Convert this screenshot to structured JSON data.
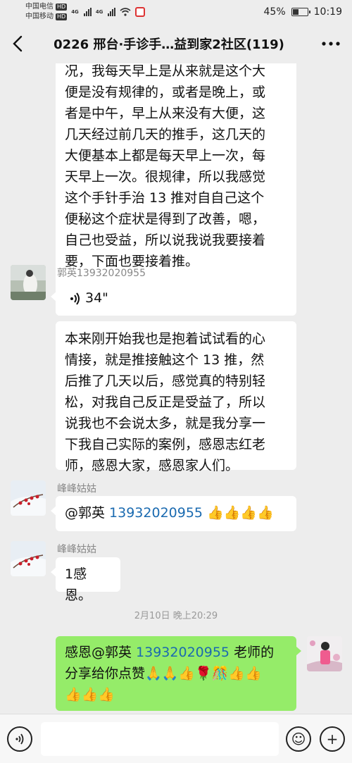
{
  "status_bar": {
    "carrier_1": "中国电信",
    "carrier_2": "中国移动",
    "hd": "HD",
    "network": "4G",
    "battery_percent": "45%",
    "battery_level": 0.45,
    "time": "10:19"
  },
  "nav": {
    "back_icon": "back-chevron-icon",
    "title": "0226 邢台·手诊手…益到家2社区(119)",
    "more_icon": "more-dots-icon"
  },
  "messages": {
    "m1": {
      "lines": [
        "况，我每天早上是从来就是这个大",
        "便是没有规律的，或者是晚上，或",
        "者是中午，早上从来没有大便，这",
        "几天经过前几天的推手，这几天的",
        "大便基本上都是每天早上一次，每",
        "天早上一次。很规律，所以我感觉",
        "这个手针手治 13 推对自自己这个",
        "便秘这个症状是得到了改善，嗯，",
        "自己也受益，所以说我说我要接着",
        "要，下面也要接着推。"
      ]
    },
    "m2": {
      "sender": "郭英13932020955",
      "voice_duration": "34\""
    },
    "m3": {
      "lines": [
        "本来刚开始我也是抱着试试看的心",
        "情接，就是推接触这个 13 推，然",
        "后推了几天以后，感觉真的特别轻",
        "松，对我自己反正是受益了，所以",
        "说我也不会说太多，就是我分享一",
        "下我自己实际的案例，感恩志红老",
        "师，感恩大家，感恩家人们。"
      ]
    },
    "m4": {
      "sender": "峰峰姑姑",
      "mention": "@郭英 ",
      "phone": "13932020955",
      "emoji": " 👍👍👍👍"
    },
    "m5": {
      "sender": "峰峰姑姑",
      "text": "1感恩。"
    },
    "time_separator": "2月10日 晚上20:29",
    "m6": {
      "prefix": "感恩@郭英 ",
      "phone": "13932020955",
      "suffix": " 老师的",
      "line2": "分享给你点赞🙏🙏👍🌹🎊👍👍",
      "line3": "👍👍👍"
    }
  },
  "input_bar": {
    "voice_icon": "voice-toggle-icon",
    "emoji_icon": "emoji-icon",
    "plus_icon": "plus-icon",
    "emoji_glyph": "☺",
    "plus_glyph": "+"
  }
}
